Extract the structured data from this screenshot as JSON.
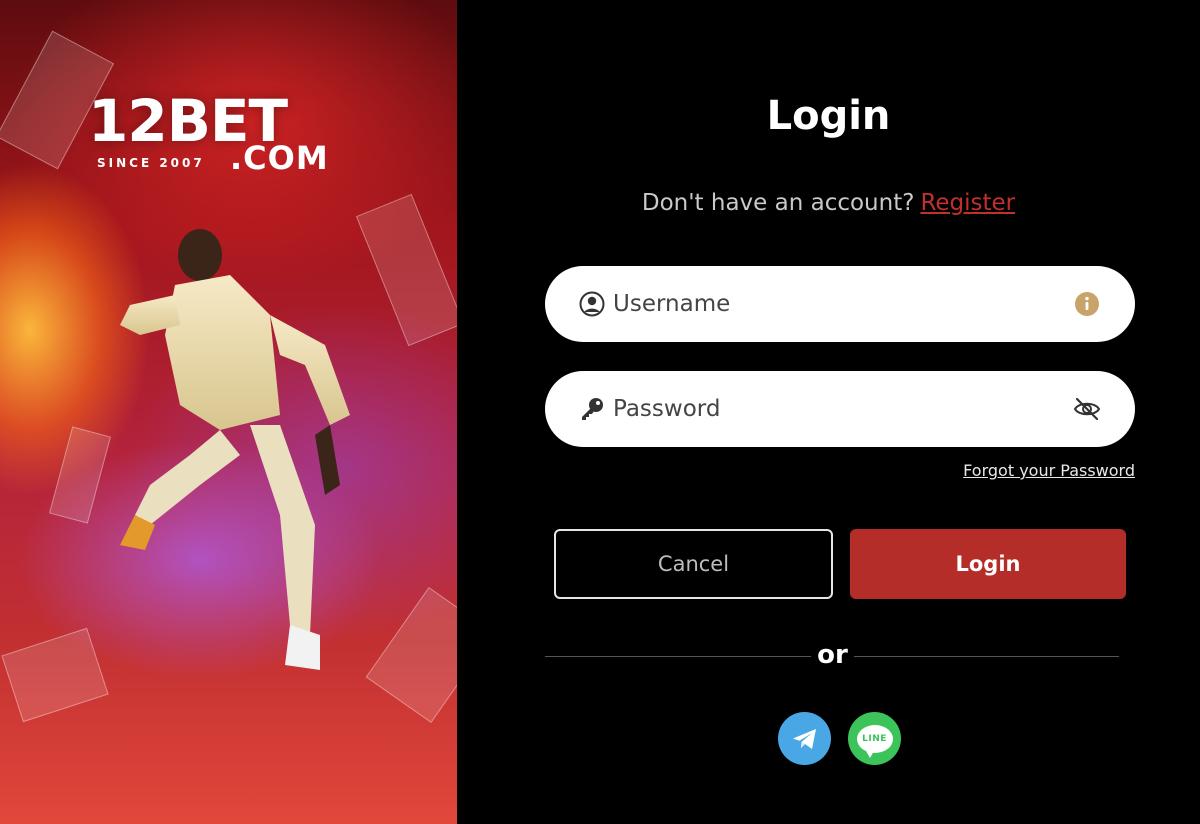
{
  "brand": {
    "logo_main": "12BET",
    "logo_since": "SINCE 2007",
    "logo_domain": ".COM"
  },
  "login": {
    "title": "Login",
    "signup_prompt": "Don't have an account?",
    "register_link": "Register",
    "username_placeholder": "Username",
    "password_placeholder": "Password",
    "forgot_link": "Forgot your Password",
    "cancel_label": "Cancel",
    "login_label": "Login",
    "divider_text": "or"
  },
  "social": {
    "line_text": "LINE"
  },
  "icons": {
    "username": "user-circle-icon",
    "password": "key-icon",
    "info": "info-icon",
    "toggle_password": "eye-slash-icon",
    "telegram": "telegram-icon",
    "line": "line-icon"
  },
  "colors": {
    "accent": "#b52d29",
    "register_link": "#c0312e",
    "info_icon": "#c9a46a",
    "telegram": "#4aa7e6",
    "line": "#3cc45a"
  }
}
